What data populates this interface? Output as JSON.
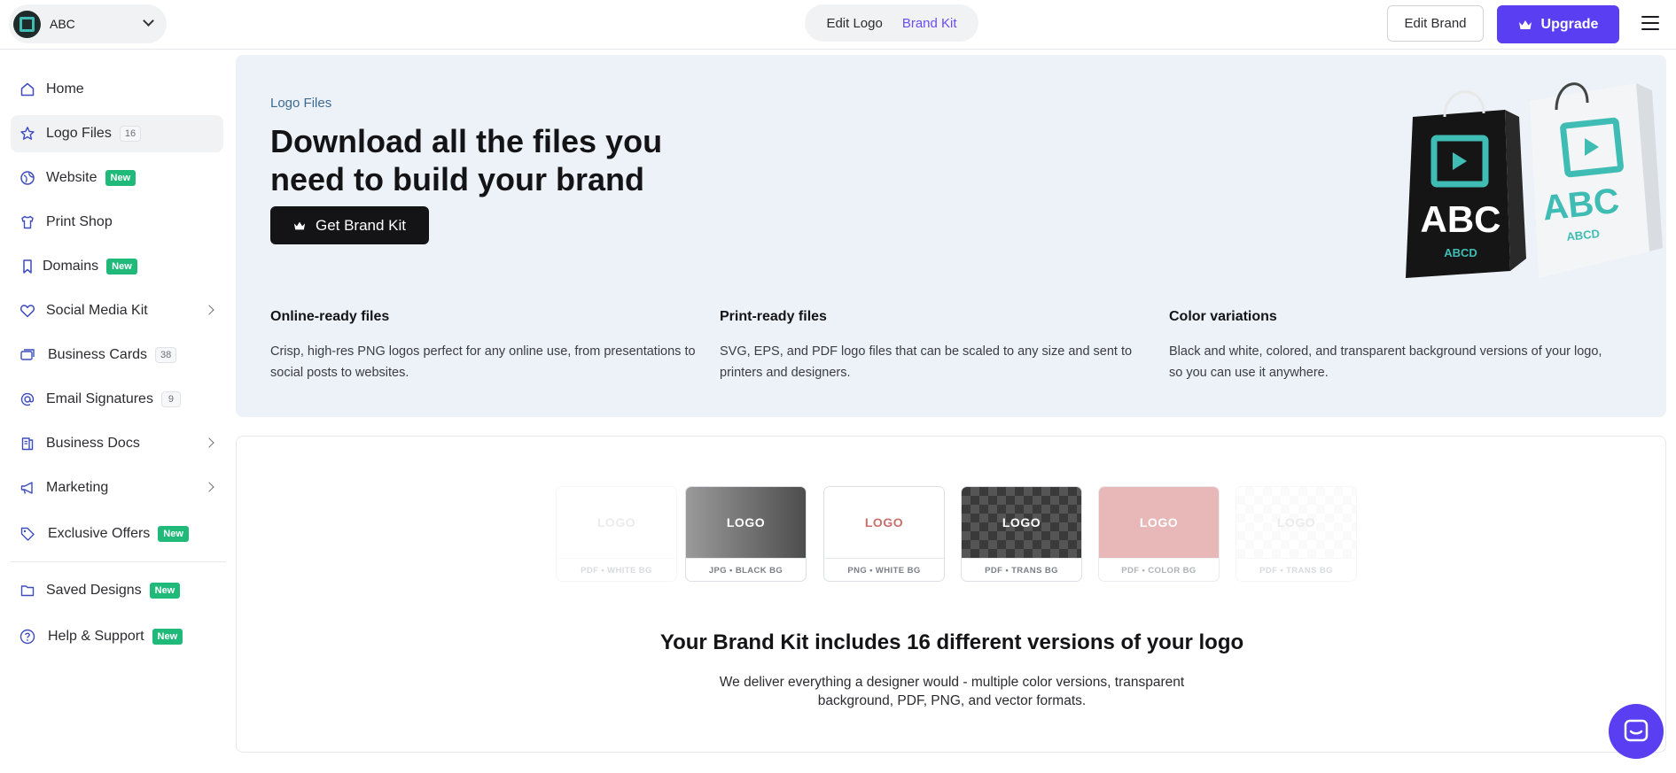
{
  "header": {
    "brand_name": "ABC",
    "tabs": [
      {
        "label": "Edit Logo",
        "active": false
      },
      {
        "label": "Brand Kit",
        "active": true
      }
    ],
    "edit_brand_label": "Edit Brand",
    "upgrade_label": "Upgrade"
  },
  "sidebar": {
    "items": [
      {
        "label": "Home",
        "icon": "home-icon"
      },
      {
        "label": "Logo Files",
        "icon": "star-icon",
        "count": "16",
        "active": true
      },
      {
        "label": "Website",
        "icon": "globe-icon",
        "badge": "New"
      },
      {
        "label": "Print Shop",
        "icon": "shirt-icon"
      },
      {
        "label": "Domains",
        "icon": "bookmark-icon",
        "badge": "New"
      },
      {
        "label": "Social Media Kit",
        "icon": "heart-icon",
        "expandable": true
      },
      {
        "label": "Business Cards",
        "icon": "card-icon",
        "count": "38"
      },
      {
        "label": "Email Signatures",
        "icon": "at-icon",
        "count": "9"
      },
      {
        "label": "Business Docs",
        "icon": "document-icon",
        "expandable": true
      },
      {
        "label": "Marketing",
        "icon": "megaphone-icon",
        "expandable": true
      },
      {
        "label": "Exclusive Offers",
        "icon": "tag-icon",
        "badge": "New"
      },
      {
        "label": "Saved Designs",
        "icon": "folder-icon",
        "badge": "New"
      },
      {
        "label": "Help & Support",
        "icon": "help-icon",
        "badge": "New"
      }
    ]
  },
  "hero": {
    "eyebrow": "Logo Files",
    "title": "Download all the files you need to build your brand",
    "cta_label": "Get Brand Kit",
    "illustration_text": "ABC",
    "illustration_subtext": "ABCD",
    "features": [
      {
        "title": "Online-ready files",
        "desc": "Crisp, high-res PNG logos perfect for any online use, from presentations to social posts to websites."
      },
      {
        "title": "Print-ready files",
        "desc": "SVG, EPS, and PDF logo files that can be scaled to any size and sent to printers and designers."
      },
      {
        "title": "Color variations",
        "desc": "Black and white, colored, and transparent background versions of your logo, so you can use it anywhere."
      }
    ]
  },
  "kit": {
    "tiles": [
      {
        "logo": "LOGO",
        "caption": "PDF • WHITE BG",
        "style": "white",
        "faded": true
      },
      {
        "logo": "LOGO",
        "caption": "JPG • BLACK BG",
        "style": "gray"
      },
      {
        "logo": "LOGO",
        "caption": "PNG • WHITE BG",
        "style": "white-red"
      },
      {
        "logo": "LOGO",
        "caption": "PDF • TRANS BG",
        "style": "checker"
      },
      {
        "logo": "LOGO",
        "caption": "PDF • COLOR BG",
        "style": "pink"
      },
      {
        "logo": "LOGO",
        "caption": "PDF • TRANS BG",
        "style": "checker-light",
        "faded": true
      }
    ],
    "heading": "Your Brand Kit includes 16 different versions of your logo",
    "desc": "We deliver everything a designer would - multiple color versions, transparent background, PDF, PNG, and vector formats."
  },
  "colors": {
    "accent": "#5a3ef2",
    "new_badge": "#1fb97a",
    "hero_bg": "#ecf2f8",
    "teal": "#3fbdb5"
  }
}
